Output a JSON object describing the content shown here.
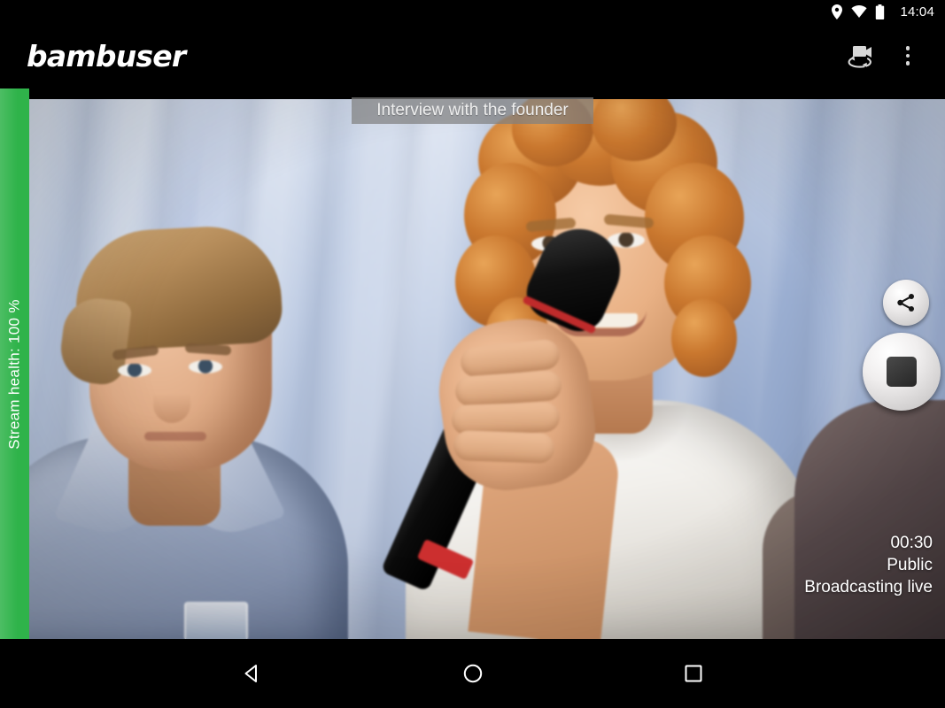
{
  "status_bar": {
    "time": "14:04",
    "icons": [
      "location-pin-icon",
      "wifi-icon",
      "battery-icon"
    ]
  },
  "app_bar": {
    "brand": "bambuser",
    "actions": [
      {
        "name": "switch-camera-icon",
        "label": "Switch camera"
      },
      {
        "name": "overflow-menu-icon",
        "label": "More options"
      }
    ]
  },
  "broadcast": {
    "title": "Interview with the founder",
    "stream_health_label": "Stream health: 100 %",
    "stream_health_percent": 100,
    "elapsed": "00:30",
    "privacy": "Public",
    "state": "Broadcasting live"
  },
  "controls": {
    "share_label": "Share",
    "stop_label": "Stop broadcast"
  },
  "nav_bar": {
    "back_label": "Back",
    "home_label": "Home",
    "recents_label": "Recents"
  },
  "colors": {
    "health_green": "#2fb34a",
    "app_background": "#000000",
    "title_chip": "rgba(128,128,128,0.72)",
    "text_primary": "#ffffff"
  }
}
